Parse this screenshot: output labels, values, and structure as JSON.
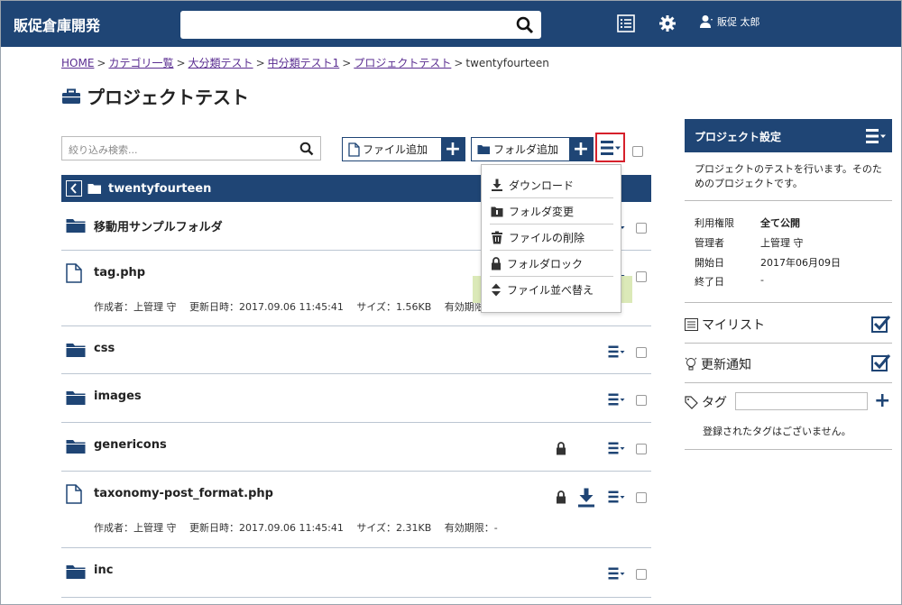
{
  "header": {
    "brand": "販促倉庫開発",
    "search_value": "",
    "user_name": "販促 太郎"
  },
  "breadcrumb": {
    "items": [
      "HOME",
      "カテゴリ一覧",
      "大分類テスト",
      "中分類テスト1",
      "プロジェクトテスト"
    ],
    "current": "twentyfourteen",
    "separator": ">"
  },
  "page_title": "プロジェクトテスト",
  "toolbar": {
    "filter_placeholder": "絞り込み検索...",
    "add_file_label": "ファイル追加",
    "add_folder_label": "フォルダ追加",
    "plus": "+"
  },
  "current_folder": "twentyfourteen",
  "dropdown": {
    "items": [
      "ダウンロード",
      "フォルダ変更",
      "ファイルの削除",
      "フォルダロック",
      "ファイル並べ替え"
    ],
    "highlighted": "ファイル並べ替え"
  },
  "files": [
    {
      "name": "移動用サンプルフォルダ",
      "type": "folder"
    },
    {
      "name": "tag.php",
      "type": "file",
      "meta": "作成者：上管理 守　 更新日時：2017.09.06 11:45:41　 サイズ：1.56KB　 有効期限"
    },
    {
      "name": "css",
      "type": "folder"
    },
    {
      "name": "images",
      "type": "folder"
    },
    {
      "name": "genericons",
      "type": "folder",
      "locked": true
    },
    {
      "name": "taxonomy-post_format.php",
      "type": "file",
      "locked": true,
      "download": true,
      "meta": "作成者：上管理 守　 更新日時：2017.09.06 11:45:41　 サイズ：2.31KB　 有効期限：-"
    },
    {
      "name": "inc",
      "type": "folder"
    }
  ],
  "sidebar": {
    "title": "プロジェクト設定",
    "description": "プロジェクトのテストを行います。そのためのプロジェクトです。",
    "props": [
      {
        "k": "利用権限",
        "v": "全て公開"
      },
      {
        "k": "管理者",
        "v": "上管理 守"
      },
      {
        "k": "開始日",
        "v": "2017年06月09日"
      },
      {
        "k": "終了日",
        "v": "-"
      }
    ],
    "mylist_label": "マイリスト",
    "notify_label": "更新通知",
    "tag_label": "タグ",
    "tag_value": "",
    "tag_empty": "登録されたタグはございません。"
  },
  "colors": {
    "primary": "#1f4575",
    "highlight": "#dbe9b8",
    "alert": "#d6202b"
  }
}
